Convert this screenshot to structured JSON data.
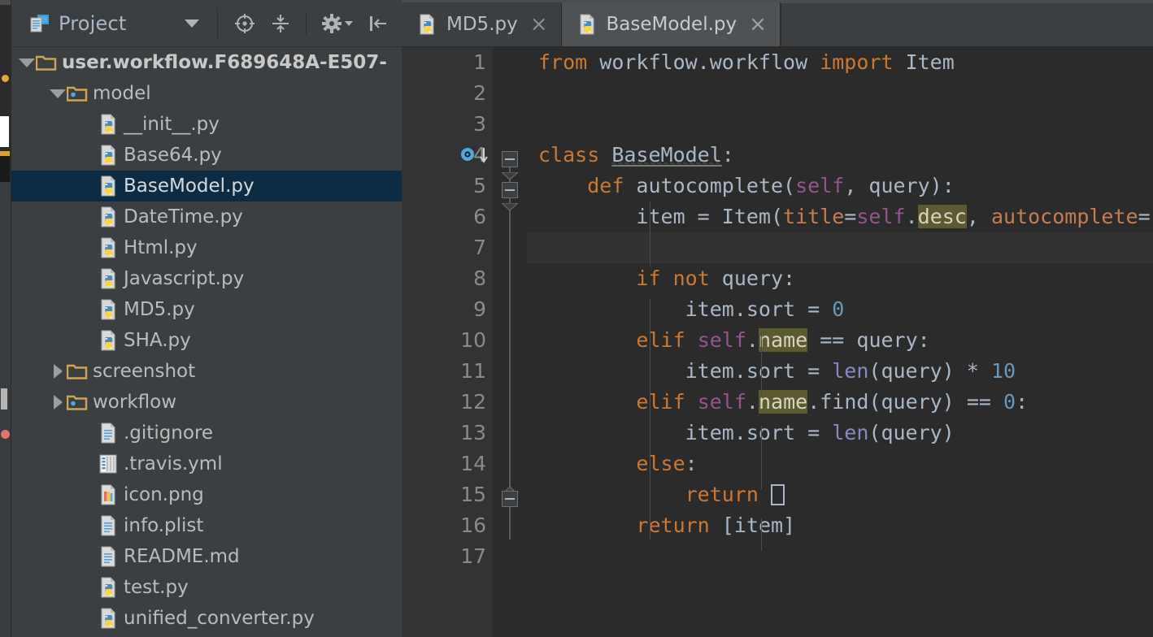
{
  "window": {
    "app": "PyCharm",
    "theme_accent": "#4e5254",
    "selection_color": "#0d2c44",
    "highlight_color": "#5c5a30"
  },
  "project_panel": {
    "title": "Project",
    "title_caret_icon": "chevron-down-icon",
    "actions": [
      {
        "name": "locate-in-tree",
        "icon": "crosshair-target-icon"
      },
      {
        "name": "collapse-all",
        "icon": "collapse-arrows-icon"
      },
      {
        "name": "settings",
        "icon": "gear-icon",
        "has_caret": true
      },
      {
        "name": "hide-panel",
        "icon": "hide-left-icon"
      }
    ],
    "tree": [
      {
        "label": "user.workflow.F689648A-E507-",
        "icon": "folder-icon",
        "indent": 0,
        "twisty": "down",
        "bold": true,
        "selected": false
      },
      {
        "label": "model",
        "icon": "module-folder-icon",
        "indent": 1,
        "twisty": "down",
        "bold": false,
        "selected": false
      },
      {
        "label": "__init__.py",
        "icon": "python-file-icon",
        "indent": 2,
        "twisty": "none",
        "bold": false,
        "selected": false
      },
      {
        "label": "Base64.py",
        "icon": "python-file-icon",
        "indent": 2,
        "twisty": "none",
        "bold": false,
        "selected": false
      },
      {
        "label": "BaseModel.py",
        "icon": "python-file-icon",
        "indent": 2,
        "twisty": "none",
        "bold": false,
        "selected": true
      },
      {
        "label": "DateTime.py",
        "icon": "python-file-icon",
        "indent": 2,
        "twisty": "none",
        "bold": false,
        "selected": false
      },
      {
        "label": "Html.py",
        "icon": "python-file-icon",
        "indent": 2,
        "twisty": "none",
        "bold": false,
        "selected": false
      },
      {
        "label": "Javascript.py",
        "icon": "python-file-icon",
        "indent": 2,
        "twisty": "none",
        "bold": false,
        "selected": false
      },
      {
        "label": "MD5.py",
        "icon": "python-file-icon",
        "indent": 2,
        "twisty": "none",
        "bold": false,
        "selected": false
      },
      {
        "label": "SHA.py",
        "icon": "python-file-icon",
        "indent": 2,
        "twisty": "none",
        "bold": false,
        "selected": false
      },
      {
        "label": "screenshot",
        "icon": "folder-icon",
        "indent": 1,
        "twisty": "right",
        "bold": false,
        "selected": false
      },
      {
        "label": "workflow",
        "icon": "module-folder-icon",
        "indent": 1,
        "twisty": "right",
        "bold": false,
        "selected": false
      },
      {
        "label": ".gitignore",
        "icon": "text-file-icon",
        "indent": 2,
        "twisty": "none",
        "bold": false,
        "selected": false
      },
      {
        "label": ".travis.yml",
        "icon": "yaml-file-icon",
        "indent": 2,
        "twisty": "none",
        "bold": false,
        "selected": false
      },
      {
        "label": "icon.png",
        "icon": "image-file-icon",
        "indent": 2,
        "twisty": "none",
        "bold": false,
        "selected": false
      },
      {
        "label": "info.plist",
        "icon": "text-file-icon",
        "indent": 2,
        "twisty": "none",
        "bold": false,
        "selected": false
      },
      {
        "label": "README.md",
        "icon": "text-file-icon",
        "indent": 2,
        "twisty": "none",
        "bold": false,
        "selected": false
      },
      {
        "label": "test.py",
        "icon": "python-file-icon",
        "indent": 2,
        "twisty": "none",
        "bold": false,
        "selected": false
      },
      {
        "label": "unified_converter.py",
        "icon": "python-file-icon",
        "indent": 2,
        "twisty": "none",
        "bold": false,
        "selected": false
      }
    ]
  },
  "editor": {
    "tabs": [
      {
        "label": "MD5.py",
        "icon": "python-file-icon",
        "active": false,
        "close_label": "×"
      },
      {
        "label": "BaseModel.py",
        "icon": "python-file-icon",
        "active": true,
        "close_label": "×"
      }
    ],
    "current_line": 7,
    "line_numbers": [
      "1",
      "2",
      "3",
      "4",
      "5",
      "6",
      "7",
      "8",
      "9",
      "10",
      "11",
      "12",
      "13",
      "14",
      "15",
      "16",
      "17"
    ],
    "gutter_markers": [
      {
        "line": 4,
        "icon": "class-implemented-marker-icon"
      }
    ],
    "code_lines": [
      {
        "n": 1,
        "text": "from workflow.workflow import Item"
      },
      {
        "n": 2,
        "text": ""
      },
      {
        "n": 3,
        "text": ""
      },
      {
        "n": 4,
        "text": "class BaseModel:"
      },
      {
        "n": 5,
        "text": "    def autocomplete(self, query):"
      },
      {
        "n": 6,
        "text": "        item = Item(title=self.desc, autocomplete="
      },
      {
        "n": 7,
        "text": ""
      },
      {
        "n": 8,
        "text": "        if not query:"
      },
      {
        "n": 9,
        "text": "            item.sort = 0"
      },
      {
        "n": 10,
        "text": "        elif self.name == query:"
      },
      {
        "n": 11,
        "text": "            item.sort = len(query) * 10"
      },
      {
        "n": 12,
        "text": "        elif self.name.find(query) == 0:"
      },
      {
        "n": 13,
        "text": "            item.sort = len(query)"
      },
      {
        "n": 14,
        "text": "        else:"
      },
      {
        "n": 15,
        "text": "            return []"
      },
      {
        "n": 16,
        "text": "        return [item]"
      },
      {
        "n": 17,
        "text": ""
      }
    ],
    "highlighted_tokens": [
      "desc",
      "name"
    ],
    "syntax_colors": {
      "keyword": "#cc7832",
      "identifier": "#a9b7c6",
      "number": "#6897bb",
      "self": "#94558d",
      "builtin_function": "#8888c6",
      "named_argument": "#c77b53",
      "background": "#2b2b2b",
      "gutter_background": "#313335",
      "current_line_background": "#323232"
    }
  }
}
